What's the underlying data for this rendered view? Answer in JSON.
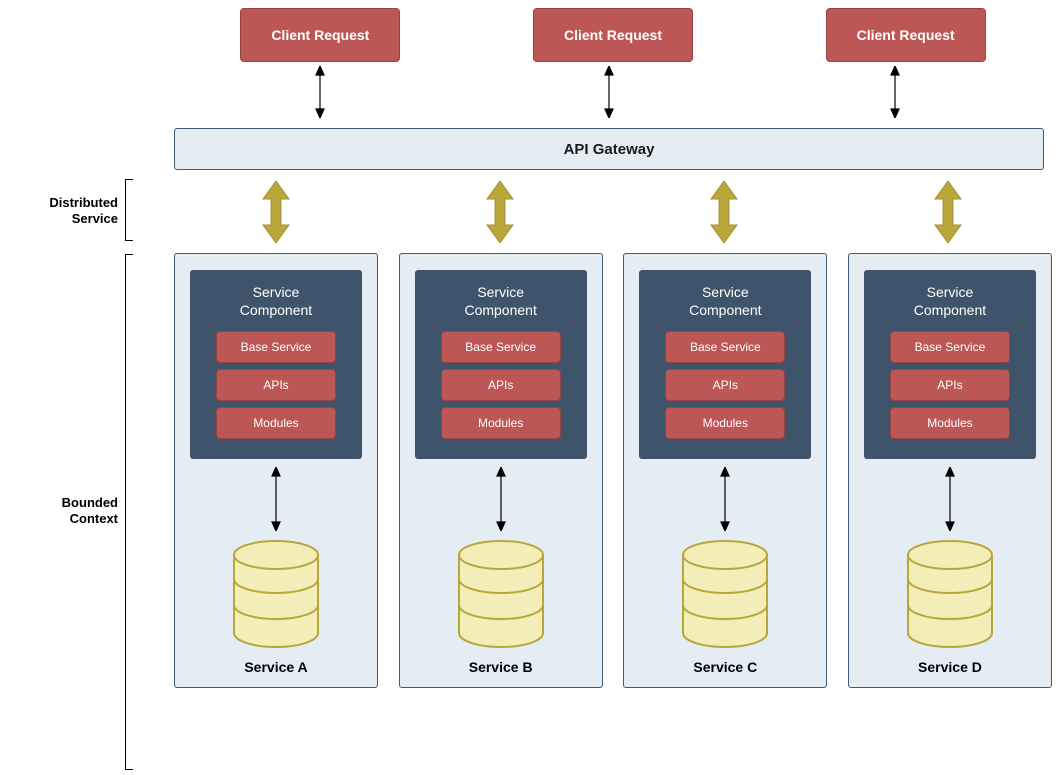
{
  "clients": [
    {
      "label": "Client Request"
    },
    {
      "label": "Client Request"
    },
    {
      "label": "Client Request"
    }
  ],
  "api_gateway": {
    "label": "API Gateway"
  },
  "labels": {
    "distributed_service_l1": "Distributed",
    "distributed_service_l2": "Service",
    "bounded_context_l1": "Bounded",
    "bounded_context_l2": "Context"
  },
  "component": {
    "title_l1": "Service",
    "title_l2": "Component",
    "base_service": "Base Service",
    "apis": "APIs",
    "modules": "Modules"
  },
  "services": [
    {
      "name": "Service A"
    },
    {
      "name": "Service B"
    },
    {
      "name": "Service C"
    },
    {
      "name": "Service D"
    }
  ]
}
